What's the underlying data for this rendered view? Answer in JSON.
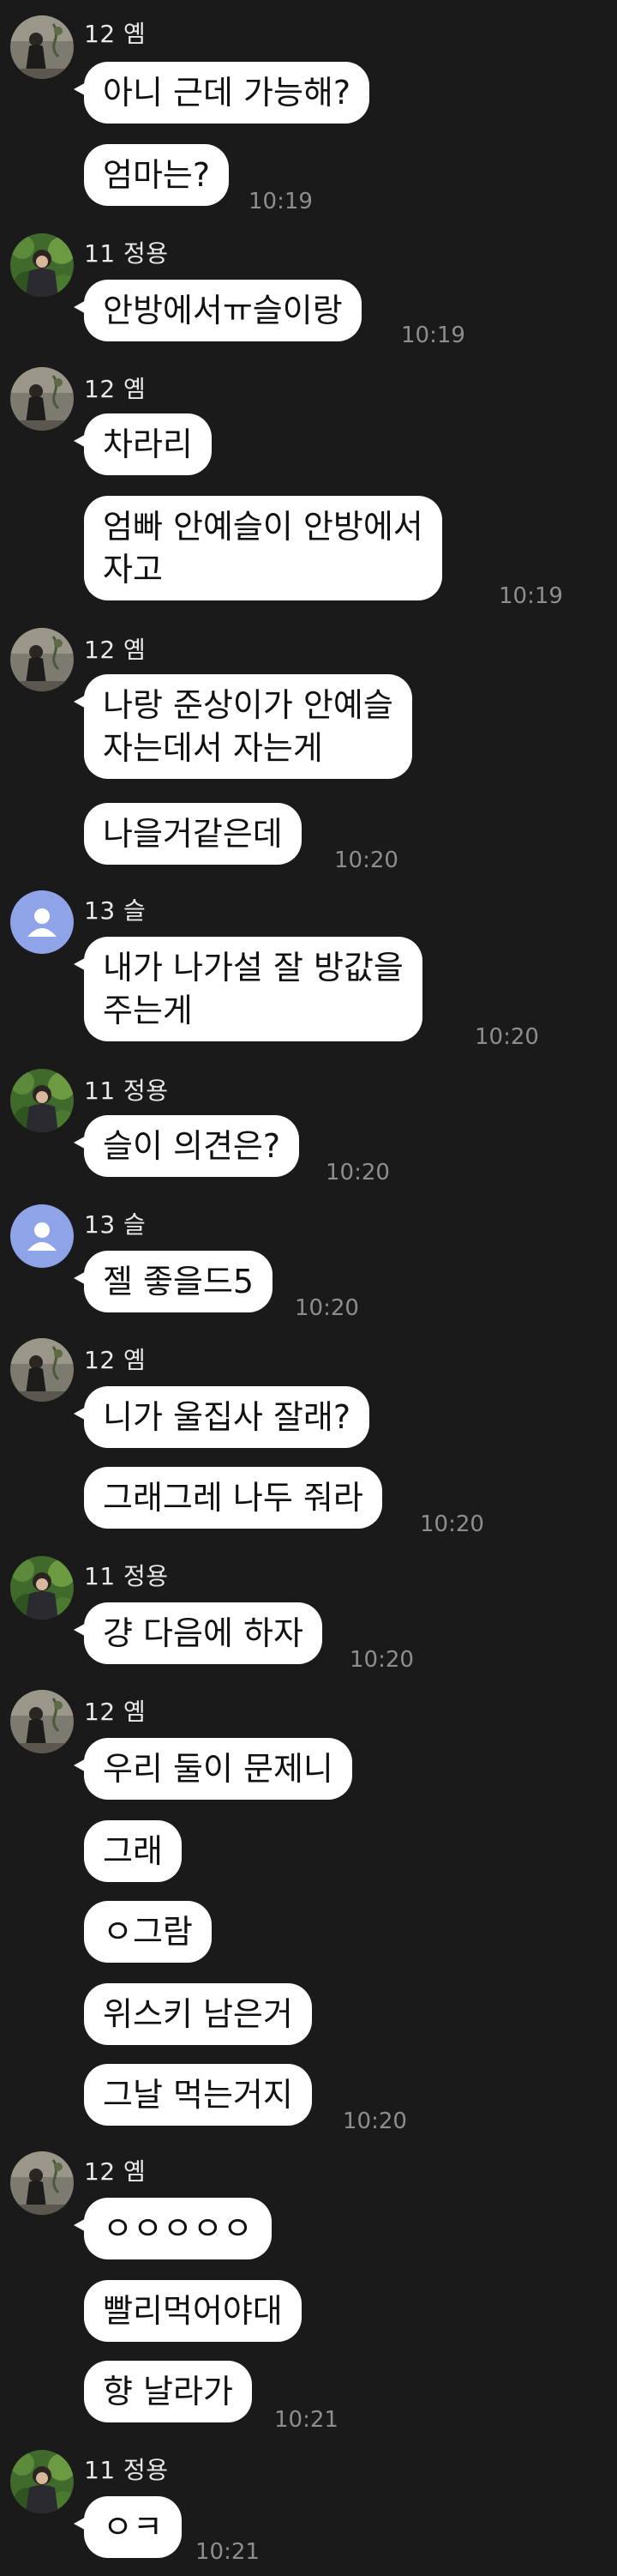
{
  "users": {
    "yem": {
      "label": "12 옘"
    },
    "jy": {
      "label": "11 정용"
    },
    "seul": {
      "label": "13 슬"
    }
  },
  "messages": [
    {
      "text": "아니 근데 가능해?"
    },
    {
      "text": "엄마는?",
      "time": "10:19"
    },
    {
      "text": "안방에서ㅠ슬이랑",
      "time": "10:19"
    },
    {
      "text": "차라리"
    },
    {
      "text": "엄빠 안예슬이 안방에서\n자고",
      "time": "10:19"
    },
    {
      "text": "나랑 준상이가 안예슬\n자는데서 자는게"
    },
    {
      "text": "나을거같은데",
      "time": "10:20"
    },
    {
      "text": "내가 나가설 잘 방값을\n주는게",
      "time": "10:20"
    },
    {
      "text": "슬이 의견은?",
      "time": "10:20"
    },
    {
      "text": "젤 좋을드5",
      "time": "10:20"
    },
    {
      "text": "니가 울집사 잘래?"
    },
    {
      "text": "그래그레 나두 줘라",
      "time": "10:20"
    },
    {
      "text": "걍 다음에 하자",
      "time": "10:20"
    },
    {
      "text": "우리 둘이 문제니"
    },
    {
      "text": "그래"
    },
    {
      "text": "ㅇ그람"
    },
    {
      "text": "위스키 남은거"
    },
    {
      "text": "그날 먹는거지",
      "time": "10:20"
    },
    {
      "text": "ㅇㅇㅇㅇㅇ"
    },
    {
      "text": "빨리먹어야대"
    },
    {
      "text": "향 날라가",
      "time": "10:21"
    },
    {
      "text": "ㅇㅋ",
      "time": "10:21"
    }
  ]
}
